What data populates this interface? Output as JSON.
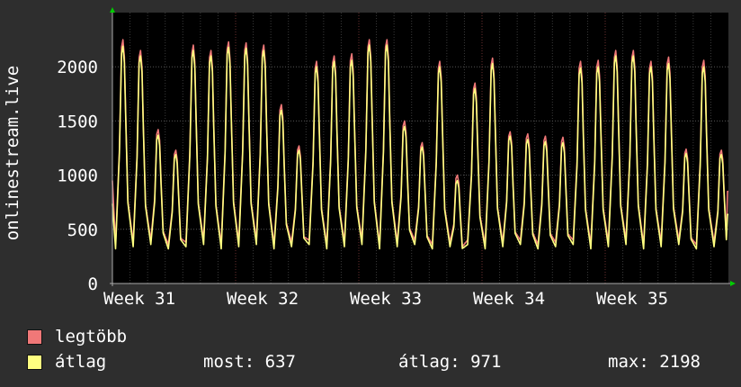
{
  "colors": {
    "background": "#2e2e2e",
    "plot_background": "#000000",
    "grid": "#4a4a4a",
    "axis": "#aaaaaa",
    "arrow": "#00cc00",
    "max_series": "#f07878",
    "avg_series": "#ffff80"
  },
  "legend": {
    "max_label": "legtöbb",
    "avg_label": "átlag"
  },
  "stats": {
    "current": "most: 637",
    "average": "átlag: 971",
    "maximum": "max: 2198"
  },
  "chart_data": {
    "type": "line",
    "ylabel": "onlinestream.live",
    "xlabel": "",
    "title": "",
    "ylim": [
      0,
      2500
    ],
    "yticks": [
      0,
      500,
      1000,
      1500,
      2000
    ],
    "xticks": [
      "Week 31",
      "Week 32",
      "Week 33",
      "Week 34",
      "Week 35"
    ],
    "xlim_days": [
      0,
      35
    ],
    "xtick_days": [
      0,
      7,
      14,
      21,
      28
    ],
    "grid": true,
    "legend_position": "bottom-left",
    "daily_peaks": {
      "days": [
        0.6,
        1.6,
        2.6,
        3.6,
        4.6,
        5.6,
        6.6,
        7.6,
        8.6,
        9.6,
        10.6,
        11.6,
        12.6,
        13.6,
        14.6,
        15.6,
        16.6,
        17.6,
        18.6,
        19.6,
        20.6,
        21.6,
        22.6,
        23.6,
        24.6,
        25.6,
        26.6,
        27.6,
        28.6,
        29.6,
        30.6,
        31.6,
        32.6,
        33.6,
        34.6
      ],
      "max_values": [
        2250,
        2150,
        1420,
        1230,
        2200,
        2150,
        2230,
        2220,
        2200,
        1650,
        1270,
        2050,
        2100,
        2120,
        2250,
        2250,
        1500,
        1300,
        2050,
        1000,
        1850,
        2080,
        1400,
        1380,
        1360,
        1350,
        2050,
        2060,
        2150,
        2150,
        2050,
        2090,
        1240,
        2060,
        1230
      ],
      "avg_values": [
        2190,
        2100,
        1370,
        1190,
        2150,
        2100,
        2180,
        2170,
        2150,
        1600,
        1230,
        2000,
        2050,
        2060,
        2200,
        2200,
        1450,
        1260,
        2000,
        950,
        1800,
        2030,
        1360,
        1330,
        1310,
        1300,
        1990,
        2000,
        2100,
        2100,
        2000,
        2030,
        1200,
        2000,
        1190
      ]
    },
    "series": [
      {
        "name": "legtöbb",
        "color": "#f07878",
        "current": 850
      },
      {
        "name": "átlag",
        "color": "#ffff80",
        "current": 637
      }
    ]
  }
}
